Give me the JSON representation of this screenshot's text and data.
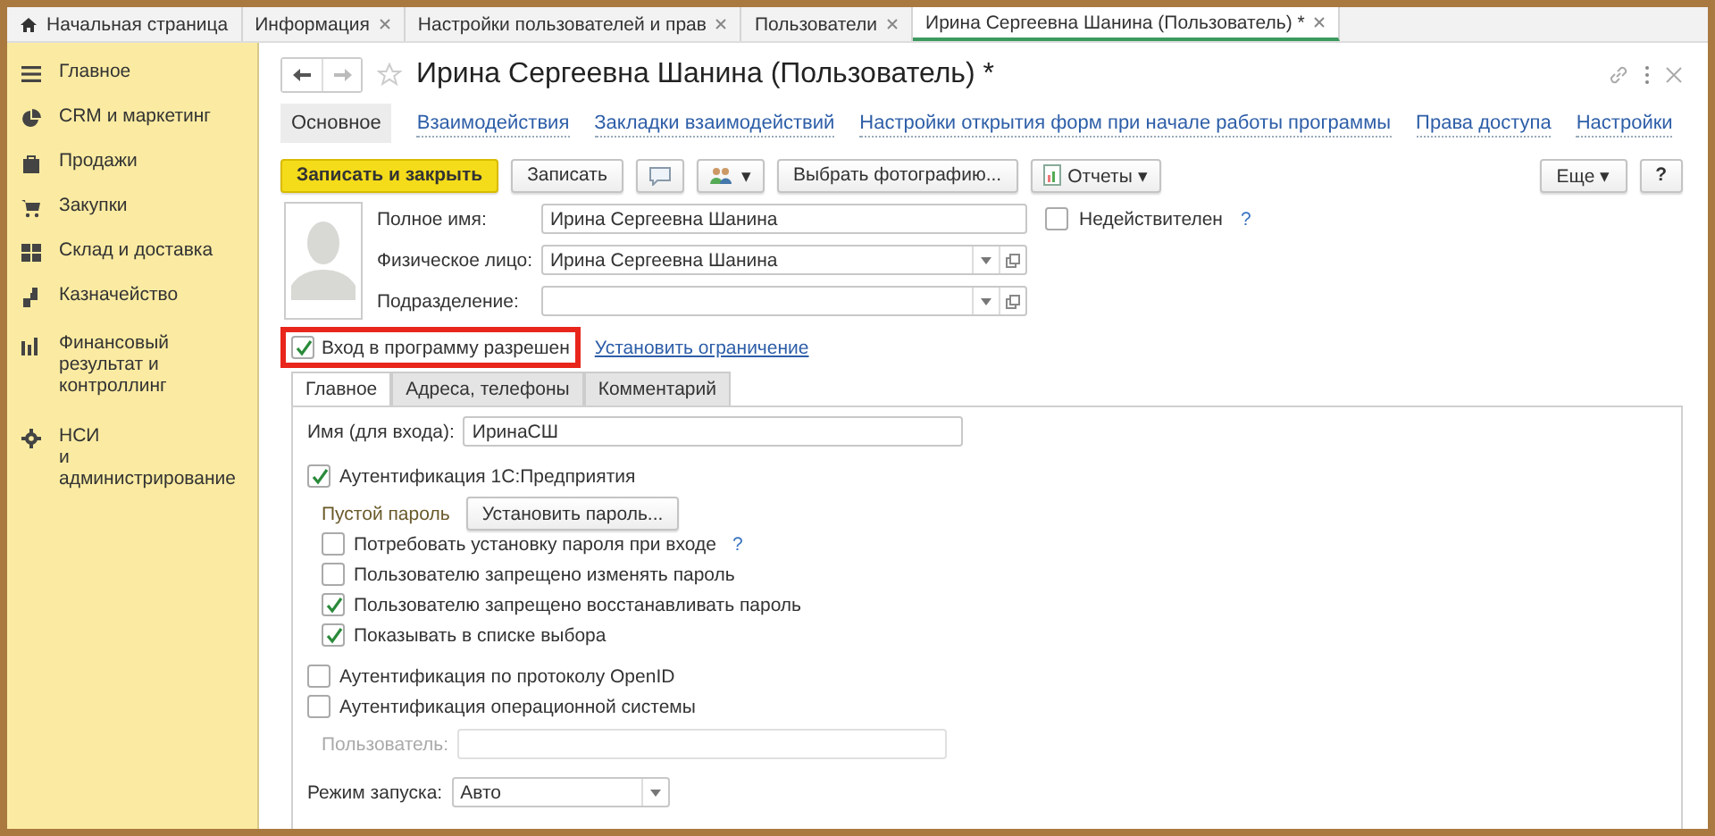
{
  "open_tabs": [
    {
      "label": "Начальная страница",
      "kind": "home",
      "selected": false
    },
    {
      "label": "Информация",
      "kind": "closable",
      "selected": false
    },
    {
      "label": "Настройки пользователей и прав",
      "kind": "closable",
      "selected": false
    },
    {
      "label": "Пользователи",
      "kind": "closable",
      "selected": false
    },
    {
      "label": "Ирина Сергеевна Шанина (Пользователь) *",
      "kind": "closable",
      "selected": true
    }
  ],
  "sidebar": {
    "items": [
      {
        "label": "Главное"
      },
      {
        "label": "CRM и маркетинг"
      },
      {
        "label": "Продажи"
      },
      {
        "label": "Закупки"
      },
      {
        "label": "Склад и доставка"
      },
      {
        "label": "Казначейство"
      },
      {
        "label": "Финансовый\nрезультат и контроллинг"
      },
      {
        "label": "НСИ\nи администрирование"
      }
    ]
  },
  "form": {
    "title": "Ирина Сергеевна Шанина (Пользователь) *",
    "sections": [
      {
        "label": "Основное",
        "selected": true
      },
      {
        "label": "Взаимодействия",
        "selected": false
      },
      {
        "label": "Закладки взаимодействий",
        "selected": false
      },
      {
        "label": "Настройки открытия форм при начале работы программы",
        "selected": false
      },
      {
        "label": "Права доступа",
        "selected": false
      },
      {
        "label": "Настройки",
        "selected": false
      }
    ],
    "toolbar": [
      {
        "kind": "primary",
        "label": "Записать и закрыть"
      },
      {
        "kind": "plain",
        "label": "Записать"
      },
      {
        "kind": "comment"
      },
      {
        "kind": "users",
        "label": "▾"
      },
      {
        "kind": "plain",
        "label": "Выбрать фотографию..."
      },
      {
        "kind": "report",
        "label": "Отчеты ▾"
      }
    ],
    "more_button": "Еще ▾",
    "help_button": "?",
    "fields": [
      {
        "label": "Полное имя:",
        "value": "Ирина Сергеевна Шанина",
        "kind": "text"
      },
      {
        "label": "Физическое лицо:",
        "value": "Ирина Сергеевна Шанина",
        "kind": "select"
      },
      {
        "label": "Подразделение:",
        "kind": "select"
      }
    ],
    "invalid": {
      "label": "Недействителен",
      "checked": false,
      "help": "?"
    },
    "login_allowed": {
      "label": "Вход в программу разрешен",
      "checked": true,
      "highlighted": true
    },
    "restriction_link": "Установить ограничение",
    "tabs": [
      {
        "label": "Главное",
        "selected": true
      },
      {
        "label": "Адреса, телефоны",
        "selected": false
      },
      {
        "label": "Комментарий",
        "selected": false
      }
    ],
    "login_name": {
      "label": "Имя (для входа):",
      "value": "ИринаСШ"
    },
    "auth_1c": {
      "label": "Аутентификация 1С:Предприятия",
      "checked": true
    },
    "password_status": "Пустой пароль",
    "set_password_button": "Установить пароль...",
    "password_options": [
      {
        "label": "Потребовать установку пароля при входе",
        "checked": false,
        "help": "?"
      },
      {
        "label": "Пользователю запрещено изменять пароль",
        "checked": false
      },
      {
        "label": "Пользователю запрещено восстанавливать пароль",
        "checked": true
      },
      {
        "label": "Показывать в списке выбора",
        "checked": true
      }
    ],
    "other_auth": [
      {
        "label": "Аутентификация по протоколу OpenID",
        "checked": false
      },
      {
        "label": "Аутентификация операционной системы",
        "checked": false
      }
    ],
    "os_user": {
      "label": "Пользователь:",
      "disabled": true
    },
    "launch_mode": {
      "label": "Режим запуска:",
      "value": "Авто"
    }
  }
}
